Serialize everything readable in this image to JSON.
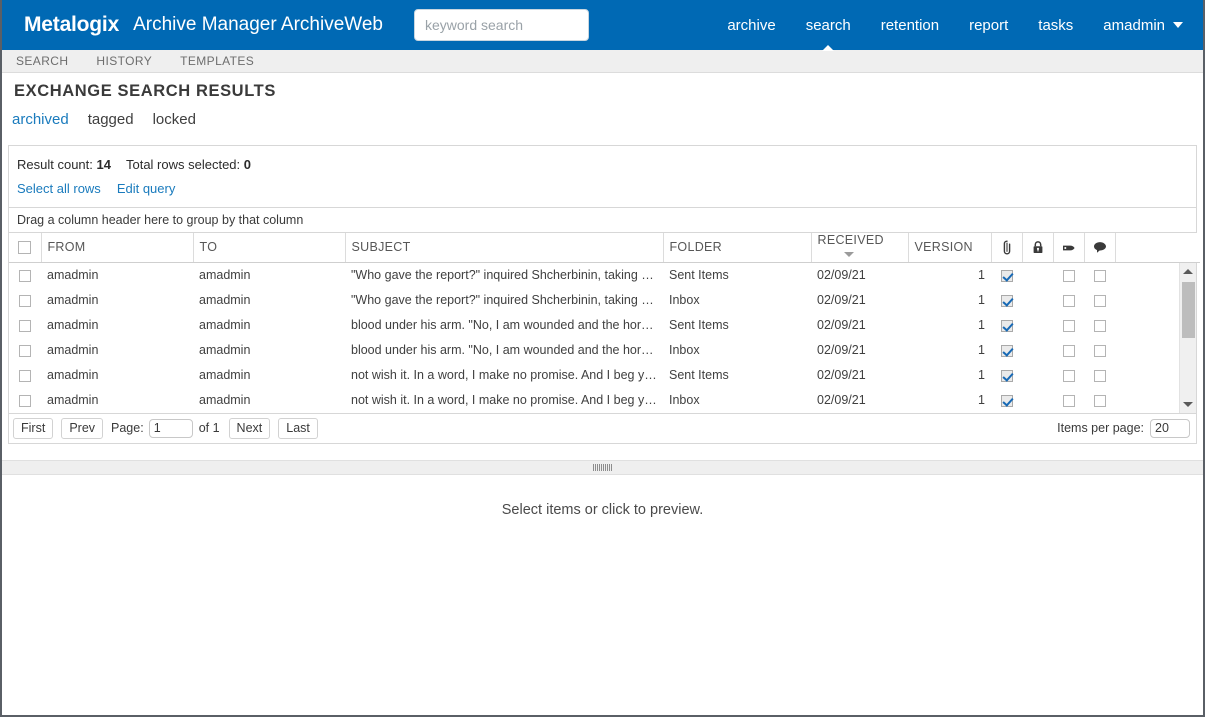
{
  "header": {
    "brand": "Metalogix",
    "app_title": "Archive Manager ArchiveWeb",
    "search_placeholder": "keyword search",
    "search_value": "",
    "nav": [
      {
        "label": "archive",
        "active": false,
        "name": "nav-archive"
      },
      {
        "label": "search",
        "active": true,
        "name": "nav-search"
      },
      {
        "label": "retention",
        "active": false,
        "name": "nav-retention"
      },
      {
        "label": "report",
        "active": false,
        "name": "nav-report"
      },
      {
        "label": "tasks",
        "active": false,
        "name": "nav-tasks"
      }
    ],
    "user": "amadmin",
    "accent_color": "#0069b4"
  },
  "subnav": [
    {
      "label": "SEARCH",
      "name": "subnav-search"
    },
    {
      "label": "HISTORY",
      "name": "subnav-history"
    },
    {
      "label": "TEMPLATES",
      "name": "subnav-templates"
    }
  ],
  "page": {
    "heading": "EXCHANGE SEARCH RESULTS",
    "filters": [
      {
        "label": "archived",
        "active": true,
        "name": "filter-archived"
      },
      {
        "label": "tagged",
        "active": false,
        "name": "filter-tagged"
      },
      {
        "label": "locked",
        "active": false,
        "name": "filter-locked"
      }
    ]
  },
  "results": {
    "result_count_label": "Result count:",
    "result_count": "14",
    "total_selected_label": "Total rows selected:",
    "total_selected": "0",
    "select_all_label": "Select all rows",
    "edit_query_label": "Edit query",
    "group_hint": "Drag a column header here to group by that column"
  },
  "grid": {
    "columns": [
      {
        "key": "check",
        "label": "",
        "name": "col-select-all"
      },
      {
        "key": "from",
        "label": "FROM",
        "name": "col-from"
      },
      {
        "key": "to",
        "label": "TO",
        "name": "col-to"
      },
      {
        "key": "subject",
        "label": "SUBJECT",
        "name": "col-subject"
      },
      {
        "key": "folder",
        "label": "FOLDER",
        "name": "col-folder"
      },
      {
        "key": "received",
        "label": "RECEIVED",
        "name": "col-received",
        "sort": "desc"
      },
      {
        "key": "version",
        "label": "VERSION",
        "name": "col-version"
      },
      {
        "key": "attachment",
        "label": "",
        "icon": "paperclip-icon",
        "name": "col-attachment"
      },
      {
        "key": "locked",
        "label": "",
        "icon": "lock-icon",
        "name": "col-locked"
      },
      {
        "key": "tag",
        "label": "",
        "icon": "tag-icon",
        "name": "col-tag"
      },
      {
        "key": "comment",
        "label": "",
        "icon": "comment-icon",
        "name": "col-comment"
      },
      {
        "key": "spacer",
        "label": "",
        "name": "col-spacer"
      }
    ],
    "rows": [
      {
        "selected": false,
        "from": "amadmin",
        "to": "amadmin",
        "subject": "\"Who gave the report?\" inquired Shcherbinin, taking the ...",
        "folder": "Sent Items",
        "received": "02/09/21",
        "version": "1",
        "attachment": true,
        "tag": false,
        "comment": false
      },
      {
        "selected": false,
        "from": "amadmin",
        "to": "amadmin",
        "subject": "\"Who gave the report?\" inquired Shcherbinin, taking the ...",
        "folder": "Inbox",
        "received": "02/09/21",
        "version": "1",
        "attachment": true,
        "tag": false,
        "comment": false
      },
      {
        "selected": false,
        "from": "amadmin",
        "to": "amadmin",
        "subject": "blood under his arm. \"No, I am wounded and the horse i...",
        "folder": "Sent Items",
        "received": "02/09/21",
        "version": "1",
        "attachment": true,
        "tag": false,
        "comment": false
      },
      {
        "selected": false,
        "from": "amadmin",
        "to": "amadmin",
        "subject": "blood under his arm. \"No, I am wounded and the horse i...",
        "folder": "Inbox",
        "received": "02/09/21",
        "version": "1",
        "attachment": true,
        "tag": false,
        "comment": false
      },
      {
        "selected": false,
        "from": "amadmin",
        "to": "amadmin",
        "subject": "not wish it. In a word, I make no promise. And I beg you ...",
        "folder": "Sent Items",
        "received": "02/09/21",
        "version": "1",
        "attachment": true,
        "tag": false,
        "comment": false
      },
      {
        "selected": false,
        "from": "amadmin",
        "to": "amadmin",
        "subject": "not wish it. In a word, I make no promise. And I beg you ...",
        "folder": "Inbox",
        "received": "02/09/21",
        "version": "1",
        "attachment": true,
        "tag": false,
        "comment": false
      }
    ]
  },
  "pager": {
    "first": "First",
    "prev": "Prev",
    "page_label": "Page:",
    "page_value": "1",
    "of_label": "of 1",
    "next": "Next",
    "last": "Last",
    "items_per_page_label": "Items per page:",
    "items_per_page_value": "20"
  },
  "preview": {
    "message": "Select items or click to preview."
  }
}
